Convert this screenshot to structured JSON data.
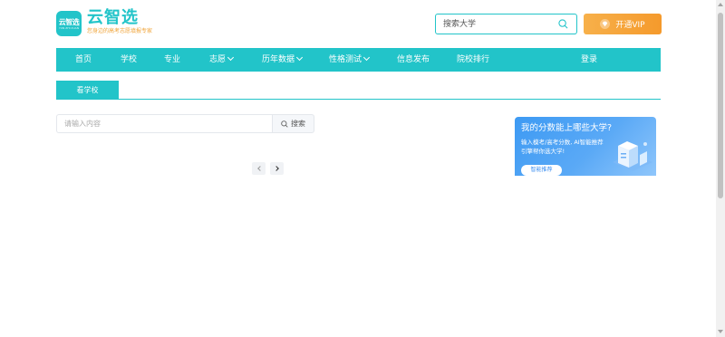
{
  "brand": {
    "logo_mark": "云智选",
    "logo_sub": "YUN ZHI XUAN",
    "name": "云智选",
    "slogan": "您身边的高考志愿填报专家"
  },
  "header": {
    "search_placeholder": "搜索大学",
    "vip_label": "开通VIP"
  },
  "nav": {
    "items": [
      {
        "label": "首页",
        "has_dropdown": false
      },
      {
        "label": "学校",
        "has_dropdown": false
      },
      {
        "label": "专业",
        "has_dropdown": false
      },
      {
        "label": "志愿",
        "has_dropdown": true
      },
      {
        "label": "历年数据",
        "has_dropdown": true
      },
      {
        "label": "性格测试",
        "has_dropdown": true
      },
      {
        "label": "信息发布",
        "has_dropdown": false
      },
      {
        "label": "院校排行",
        "has_dropdown": false
      }
    ],
    "login_label": "登录"
  },
  "tabs": {
    "active_label": "看学校"
  },
  "filter": {
    "placeholder": "请输入内容",
    "search_label": "搜索"
  },
  "banner": {
    "title": "我的分数能上哪些大学?",
    "desc_line1": "输入模考/高考分数, AI智能推荐",
    "desc_line2": "引擎帮你选大学!",
    "button_label": "智能推荐"
  },
  "colors": {
    "primary": "#22c4c9",
    "vip": "#f6a33a",
    "banner": "#4a9ff5"
  },
  "icons": {
    "search": "search-icon",
    "vip": "diamond-icon",
    "prev": "chevron-left-icon",
    "next": "chevron-right-icon"
  }
}
